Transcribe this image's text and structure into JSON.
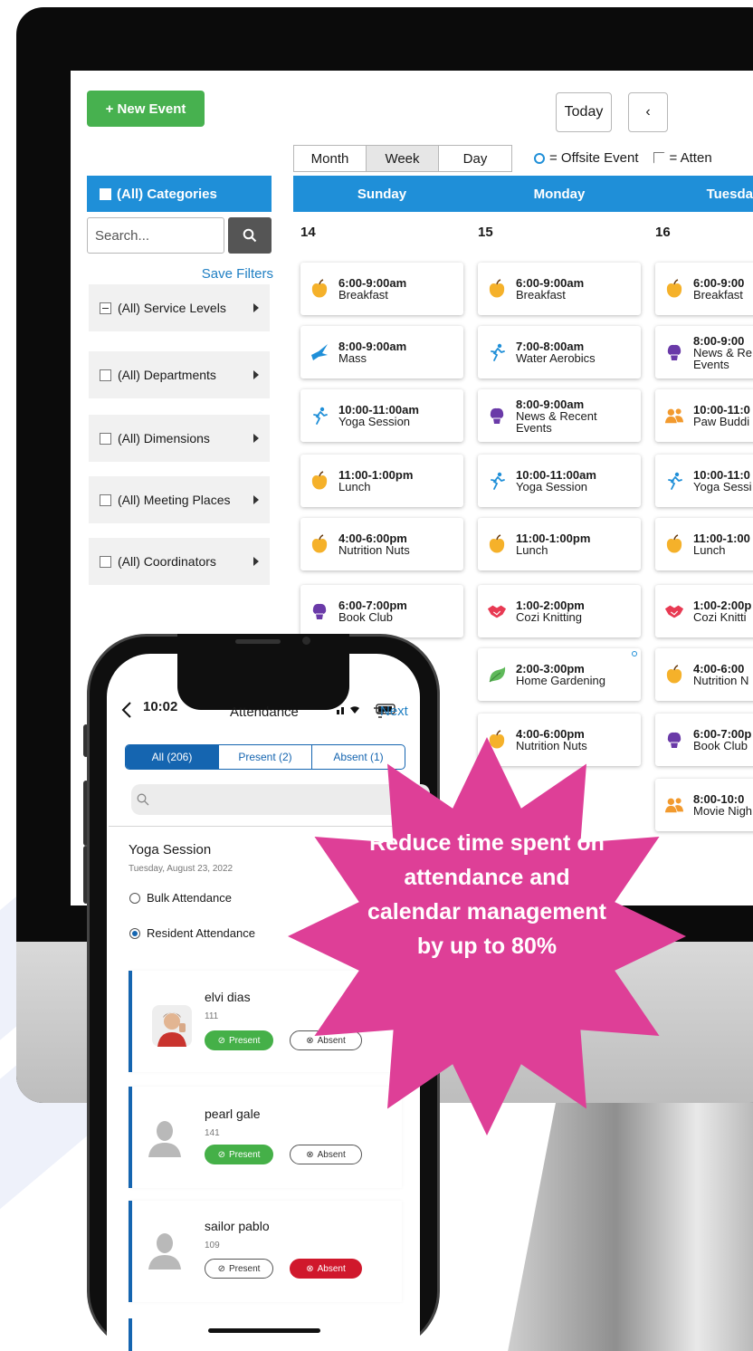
{
  "desktop": {
    "new_event_label": "+ New Event",
    "today_label": "Today",
    "prev_label": "‹",
    "views": {
      "month": "Month",
      "week": "Week",
      "day": "Day",
      "active": "Week"
    },
    "legend": {
      "offsite": "= Offsite Event",
      "attendance": "= Atten"
    },
    "categories_header": "(All) Categories",
    "search_placeholder": "Search...",
    "save_filters": "Save Filters",
    "filters": [
      "(All) Service Levels",
      "(All) Departments",
      "(All) Dimensions",
      "(All) Meeting Places",
      "(All) Coordinators"
    ],
    "days": [
      {
        "name": "Sunday",
        "date": "14"
      },
      {
        "name": "Monday",
        "date": "15"
      },
      {
        "name": "Tuesda",
        "date": "16"
      }
    ],
    "events": {
      "sunday": [
        {
          "time": "6:00-9:00am",
          "title": "Breakfast",
          "icon": "apple-icon"
        },
        {
          "time": "8:00-9:00am",
          "title": "Mass",
          "icon": "dove-icon"
        },
        {
          "time": "10:00-11:00am",
          "title": "Yoga Session",
          "icon": "running-person-icon"
        },
        {
          "time": "11:00-1:00pm",
          "title": "Lunch",
          "icon": "apple-icon"
        },
        {
          "time": "4:00-6:00pm",
          "title": "Nutrition Nuts",
          "icon": "apple-icon"
        },
        {
          "time": "6:00-7:00pm",
          "title": "Book Club",
          "icon": "brain-icon"
        }
      ],
      "monday": [
        {
          "time": "6:00-9:00am",
          "title": "Breakfast",
          "icon": "apple-icon"
        },
        {
          "time": "7:00-8:00am",
          "title": "Water Aerobics",
          "icon": "running-person-icon"
        },
        {
          "time": "8:00-9:00am",
          "title": "News & Recent",
          "title2": "Events",
          "icon": "brain-icon"
        },
        {
          "time": "10:00-11:00am",
          "title": "Yoga Session",
          "icon": "running-person-icon"
        },
        {
          "time": "11:00-1:00pm",
          "title": "Lunch",
          "icon": "apple-icon"
        },
        {
          "time": "1:00-2:00pm",
          "title": "Cozi Knitting",
          "icon": "handshake-icon"
        },
        {
          "time": "2:00-3:00pm",
          "title": "Home Gardening",
          "icon": "leaf-icon"
        },
        {
          "time": "4:00-6:00pm",
          "title": "Nutrition Nuts",
          "icon": "apple-icon"
        }
      ],
      "tuesday": [
        {
          "time": "6:00-9:00",
          "title": "Breakfast",
          "icon": "apple-icon"
        },
        {
          "time": "8:00-9:00",
          "title": "News & Re",
          "title2": "Events",
          "icon": "brain-icon"
        },
        {
          "time": "10:00-11:0",
          "title": "Paw Buddi",
          "icon": "people-icon"
        },
        {
          "time": "10:00-11:0",
          "title": "Yoga Sessi",
          "icon": "running-person-icon"
        },
        {
          "time": "11:00-1:00",
          "title": "Lunch",
          "icon": "apple-icon"
        },
        {
          "time": "1:00-2:00p",
          "title": "Cozi Knitti",
          "icon": "handshake-icon"
        },
        {
          "time": "4:00-6:00",
          "title": "Nutrition N",
          "icon": "apple-icon"
        },
        {
          "time": "6:00-7:00p",
          "title": "Book Club",
          "icon": "brain-icon"
        },
        {
          "time": "8:00-10:0",
          "title": "Movie Nigh",
          "icon": "people-icon"
        }
      ]
    },
    "colors": {
      "accent": "#1f8fd8",
      "green": "#47b14f"
    }
  },
  "phone": {
    "time": "10:02",
    "title": "Attendance",
    "next_label": "Next",
    "segments": {
      "all": "All (206)",
      "present": "Present (2)",
      "absent": "Absent (1)"
    },
    "session_title": "Yoga Session",
    "session_date": "Tuesday, August 23, 2022",
    "bulk_label": "Bulk Attendance",
    "resident_label": "Resident Attendance",
    "residents": [
      {
        "name": "elvi  dias",
        "id": "111",
        "status": "present"
      },
      {
        "name": "pearl  gale",
        "id": "141",
        "status": "present"
      },
      {
        "name": "sailor  pablo",
        "id": "109",
        "status": "absent"
      }
    ],
    "present_label": "Present",
    "absent_label": "Absent",
    "colors": {
      "blue": "#1565b0",
      "present": "#45b048",
      "absent": "#d0182c"
    }
  },
  "badge": {
    "text": "Reduce time spent on attendance and calendar management by up to 80%",
    "color": "#de3f97"
  }
}
